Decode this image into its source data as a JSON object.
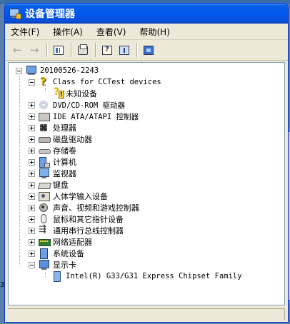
{
  "window": {
    "title": "设备管理器"
  },
  "menu": [
    {
      "label": "文件(F)"
    },
    {
      "label": "操作(A)"
    },
    {
      "label": "查看(V)"
    },
    {
      "label": "帮助(H)"
    }
  ],
  "toolbar": {
    "back_glyph": "←",
    "forward_glyph": "→"
  },
  "tree": {
    "root": {
      "label": "20100526-2243",
      "icon": "computer-icon"
    },
    "class_cctest": {
      "label": "Class for CCTest devices",
      "icon": "question-icon"
    },
    "unknown_device": {
      "label": "未知设备",
      "icon": "warning-icon"
    },
    "categories": [
      {
        "label": "DVD/CD-ROM 驱动器",
        "icon": "cdrom-icon"
      },
      {
        "label": "IDE ATA/ATAPI 控制器",
        "icon": "ide-controller-icon"
      },
      {
        "label": "处理器",
        "icon": "processor-icon"
      },
      {
        "label": "磁盘驱动器",
        "icon": "disk-drive-icon"
      },
      {
        "label": "存储卷",
        "icon": "storage-volume-icon"
      },
      {
        "label": "计算机",
        "icon": "computer-icon"
      },
      {
        "label": "监视器",
        "icon": "monitor-icon"
      },
      {
        "label": "键盘",
        "icon": "keyboard-icon"
      },
      {
        "label": "人体学输入设备",
        "icon": "hid-icon"
      },
      {
        "label": "声音、视频和游戏控制器",
        "icon": "sound-icon"
      },
      {
        "label": "鼠标和其它指针设备",
        "icon": "mouse-icon"
      },
      {
        "label": "通用串行总线控制器",
        "icon": "usb-icon"
      },
      {
        "label": "网络适配器",
        "icon": "network-adapter-icon"
      },
      {
        "label": "系统设备",
        "icon": "system-device-icon"
      }
    ],
    "display": {
      "label": "显示卡",
      "icon": "display-adapter-icon"
    },
    "gpu": {
      "label": "Intel(R) G33/G31 Express Chipset Family",
      "icon": "gpu-icon"
    }
  },
  "background": {
    "left_digit": "3"
  }
}
